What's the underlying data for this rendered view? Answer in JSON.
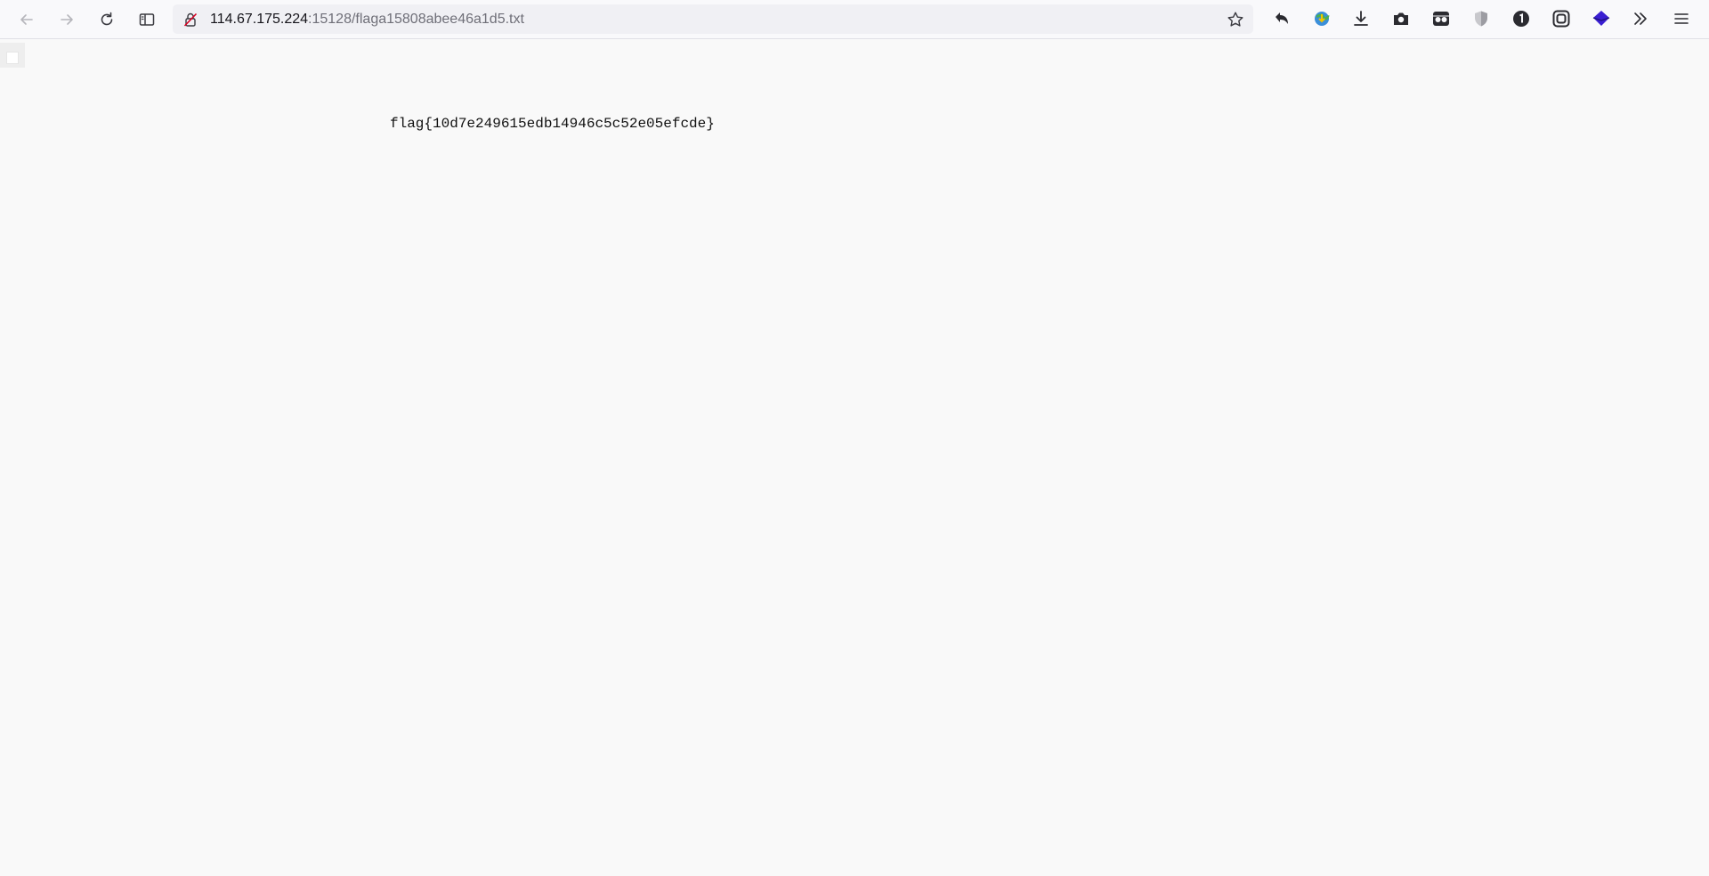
{
  "browser": {
    "url_host": "114.67.175.224",
    "url_rest": ":15128/flaga15808abee46a1d5.txt",
    "icons": {
      "back": "back-arrow-icon",
      "forward": "forward-arrow-icon",
      "reload": "reload-icon",
      "sidebar": "sidebar-icon",
      "lock": "insecure-lock-icon",
      "bookmark": "star-icon",
      "extensions": [
        "undo-arrow-icon",
        "globe-download-icon",
        "download-icon",
        "camera-icon",
        "eyes-icon",
        "shield-icon",
        "onepassword-icon",
        "link-icon",
        "diamond-icon",
        "chevron-double-right-icon",
        "menu-icon"
      ]
    }
  },
  "document": {
    "text": "flag{10d7e249615edb14946c5c52e05efcde}"
  },
  "colors": {
    "toolbar_bg": "#f9f9fb",
    "urlbar_bg": "#f0f0f4",
    "page_bg": "#f9f9f9",
    "lock_accent": "#d70022",
    "diamond": "#3a1fd1"
  }
}
